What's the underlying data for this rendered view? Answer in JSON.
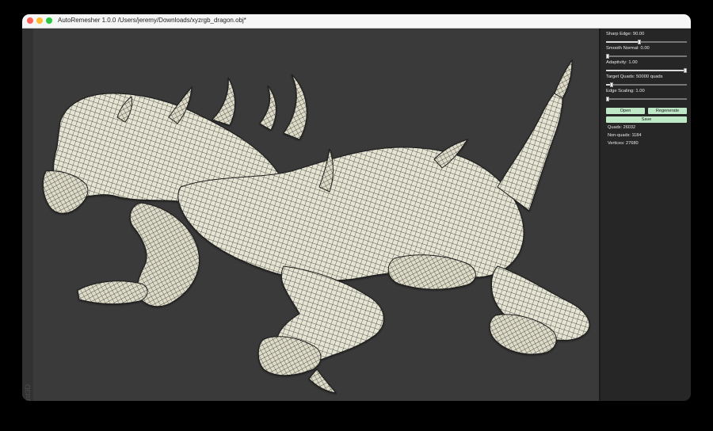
{
  "window": {
    "title": "AutoRemesher 1.0.0 /Users/jeremy/Downloads/xyzrgb_dragon.obj*"
  },
  "viewport": {
    "vertical_label": "Dust3D",
    "model_icon": "dragon-mesh-icon"
  },
  "panel": {
    "sharp_edge": {
      "label": "Sharp Edge: 90.00",
      "fraction": 0.41
    },
    "smooth_normal": {
      "label": "Smooth Normal: 0.00",
      "fraction": 0.0
    },
    "adaptivity": {
      "label": "Adaptivity: 1.00",
      "fraction": 1.0
    },
    "target_quads": {
      "label": "Target Quads: 50000 quads",
      "fraction": 0.05
    },
    "edge_scaling": {
      "label": "Edge Scaling: 1.00",
      "fraction": 0.0
    },
    "buttons": {
      "open": "Open",
      "regenerate": "Regenerate",
      "save": "Save"
    },
    "stats": {
      "quads": "Quads: 26032",
      "non_quads": "Non-quads: 1184",
      "vertices": "Vertices: 27680"
    }
  },
  "colors": {
    "button_bg": "#bfe8c7",
    "mesh_fill": "#e6e4d2",
    "viewport_bg": "#3a3a3a",
    "panel_bg": "#262626"
  }
}
